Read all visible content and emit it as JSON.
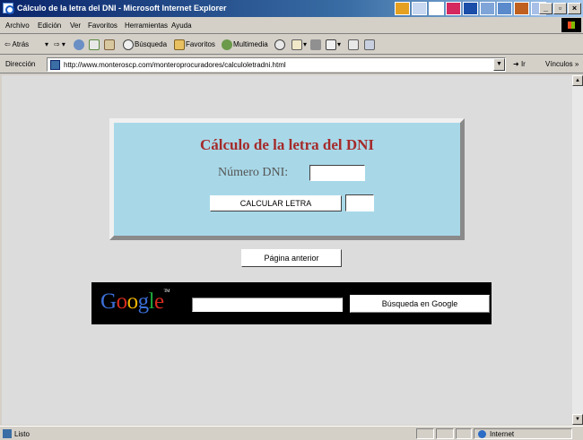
{
  "window": {
    "title": "Cálculo de la letra del DNI - Microsoft Internet Explorer",
    "buttons": [
      "_",
      "▫",
      "×"
    ]
  },
  "menu": {
    "items": [
      "Archivo",
      "Edición",
      "Ver",
      "Favoritos",
      "Herramientas",
      "Ayuda"
    ]
  },
  "toolbar": {
    "back": "⇦ Atrás",
    "search": "Búsqueda",
    "favorites": "Favoritos",
    "multimedia": "Multimedia"
  },
  "address": {
    "label": "Dirección",
    "url": "http://www.monteroscp.com/monteroprocuradores/calculoletradni.html",
    "go": "Ir",
    "links": "Vínculos »"
  },
  "page": {
    "heading": "Cálculo de la letra del DNI",
    "dni_label": "Número DNI:",
    "dni_value": "",
    "calc_button": "CALCULAR LETRA",
    "letter_value": "",
    "prev_button": "Página anterior",
    "google": {
      "logo_letters": [
        "G",
        "o",
        "o",
        "g",
        "l",
        "e"
      ],
      "logo_colors": [
        "#3b6fd8",
        "#d52b1e",
        "#f0b400",
        "#3b6fd8",
        "#1fa83c",
        "#d52b1e"
      ],
      "tm": "TM",
      "search_value": "",
      "button": "Búsqueda en Google"
    }
  },
  "status": {
    "text": "Listo",
    "zone": "Internet"
  }
}
